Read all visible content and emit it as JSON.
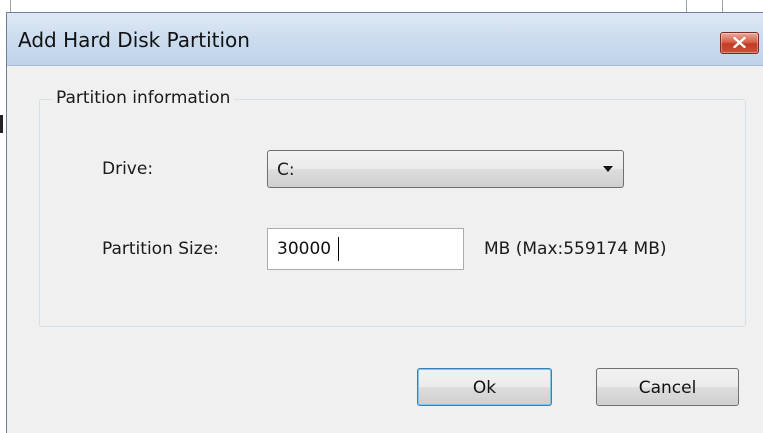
{
  "dialog": {
    "title": "Add Hard Disk Partition",
    "close_icon": "close-x-icon"
  },
  "partition_group": {
    "legend": "Partition information",
    "drive_label": "Drive:",
    "drive_value": "C:",
    "size_label": "Partition Size:",
    "size_value": "30000",
    "size_hint": "MB (Max:559174 MB)"
  },
  "buttons": {
    "ok": "Ok",
    "cancel": "Cancel"
  },
  "colors": {
    "title_bar": "#cdddef",
    "close_button": "#c9523a",
    "dialog_bg": "#f0f0f0"
  }
}
